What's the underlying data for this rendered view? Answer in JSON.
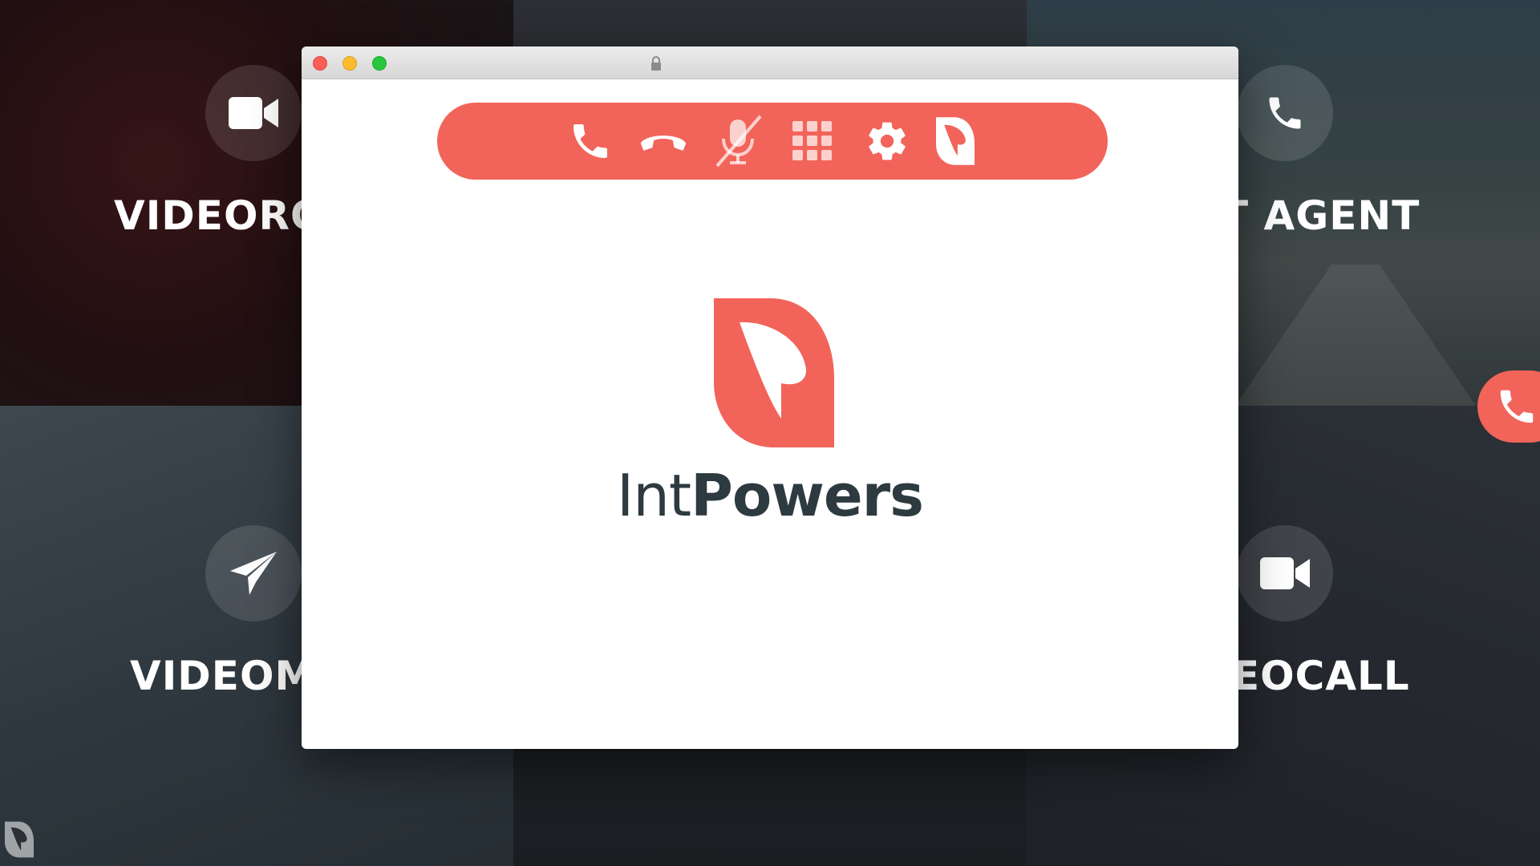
{
  "background": {
    "tiles": [
      {
        "label": "VIDEORO",
        "icon": "video-camera-icon"
      },
      {
        "label": "",
        "icon": ""
      },
      {
        "label": "T AGENT",
        "icon": "phone-icon"
      },
      {
        "label": "VIDEOM",
        "icon": "paper-plane-icon"
      },
      {
        "label": "",
        "icon": ""
      },
      {
        "label": "EOCALL",
        "icon": "video-camera-icon"
      }
    ],
    "side_button_icon": "phone-icon",
    "corner_logo_icon": "intpowers-logo-icon"
  },
  "window": {
    "controls": [
      "close",
      "minimize",
      "maximize"
    ],
    "title_icon": "lock-icon"
  },
  "toolbar": {
    "items": [
      {
        "name": "call",
        "icon": "phone-icon"
      },
      {
        "name": "hangup",
        "icon": "hang-up-icon"
      },
      {
        "name": "mute",
        "icon": "microphone-muted-icon"
      },
      {
        "name": "dialpad",
        "icon": "keypad-grid-icon"
      },
      {
        "name": "settings",
        "icon": "gear-icon"
      },
      {
        "name": "intpowers",
        "icon": "intpowers-logo-icon"
      }
    ]
  },
  "brand": {
    "name_light": "Int",
    "name_bold": "Powers"
  },
  "colors": {
    "accent": "#f2645a",
    "wordmark": "#2d3a40",
    "white": "#ffffff"
  }
}
